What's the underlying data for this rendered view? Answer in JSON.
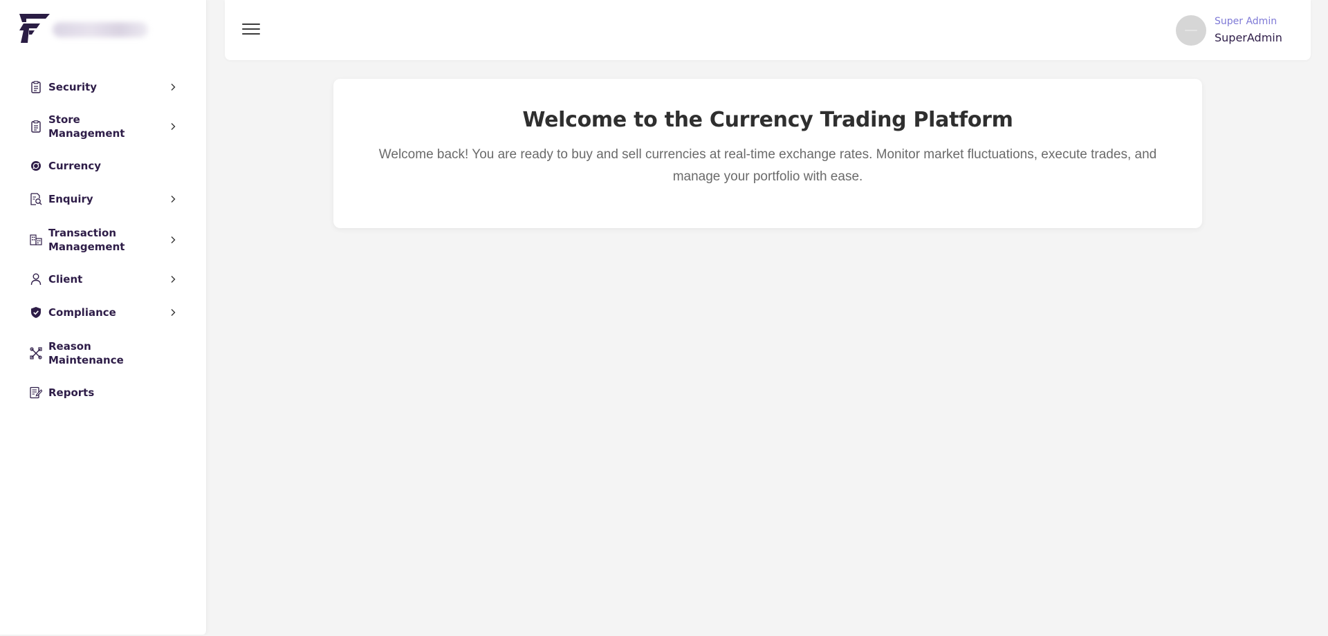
{
  "sidebar": {
    "logo_icon": "falcon-f-logo-icon",
    "items": [
      {
        "label": "Security",
        "icon": "clipboard-icon",
        "has_chevron": true
      },
      {
        "label": "Store Management",
        "icon": "clipboard-icon",
        "has_chevron": true
      },
      {
        "label": "Currency",
        "icon": "currency-exchange-icon",
        "has_chevron": false
      },
      {
        "label": "Enquiry",
        "icon": "search-document-icon",
        "has_chevron": true
      },
      {
        "label": "Transaction Management",
        "icon": "building-icon",
        "has_chevron": true
      },
      {
        "label": "Client",
        "icon": "user-icon",
        "has_chevron": true
      },
      {
        "label": "Compliance",
        "icon": "shield-check-icon",
        "has_chevron": true
      },
      {
        "label": "Reason Maintenance",
        "icon": "tools-icon",
        "has_chevron": false
      },
      {
        "label": "Reports",
        "icon": "report-edit-icon",
        "has_chevron": false
      }
    ]
  },
  "header": {
    "menu_icon": "hamburger-menu-icon",
    "user": {
      "role": "Super Admin",
      "name": "SuperAdmin",
      "dropdown_icon": "chevron-down-icon"
    }
  },
  "main": {
    "title": "Welcome to the Currency Trading Platform",
    "message": "Welcome back! You are ready to buy and sell currencies at real-time exchange rates. Monitor market fluctuations, execute trades, and manage your portfolio with ease."
  },
  "colors": {
    "nav_text": "#2e1d48",
    "role_text": "#7e79d6",
    "background": "#f4f4f4",
    "card": "#ffffff"
  }
}
